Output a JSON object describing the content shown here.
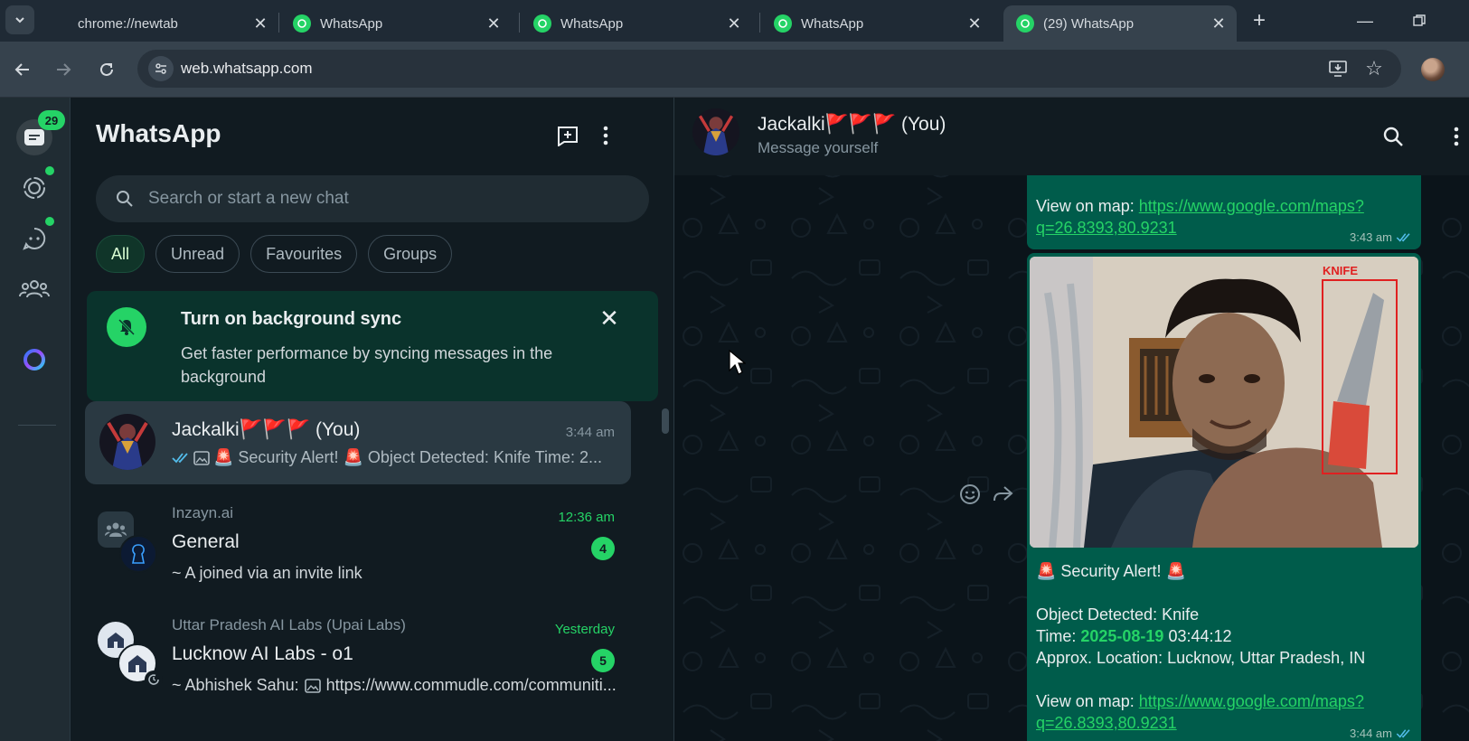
{
  "browser": {
    "tabs": [
      {
        "title": "chrome://newtab",
        "favicon": "none"
      },
      {
        "title": "WhatsApp",
        "favicon": "whatsapp-icon"
      },
      {
        "title": "WhatsApp",
        "favicon": "whatsapp-icon"
      },
      {
        "title": "WhatsApp",
        "favicon": "whatsapp-icon"
      },
      {
        "title": "(29) WhatsApp",
        "favicon": "whatsapp-icon",
        "active": true
      }
    ],
    "url": "web.whatsapp.com"
  },
  "rail": {
    "chats_badge": "29",
    "items": [
      "chats-icon",
      "status-icon",
      "channels-icon",
      "communities-icon",
      "meta-ai-icon"
    ]
  },
  "sidebar": {
    "title": "WhatsApp",
    "search_placeholder": "Search or start a new chat",
    "filters": [
      "All",
      "Unread",
      "Favourites",
      "Groups"
    ],
    "sync_banner": {
      "title": "Turn on background sync",
      "text": "Get faster performance by syncing messages in the background"
    },
    "chats": [
      {
        "name": "Jackalki🚩🚩🚩 (You)",
        "time": "3:44 am",
        "preview": "🚨 Security Alert! 🚨 Object Detected: Knife Time: 2..."
      },
      {
        "community": "Inzayn.ai",
        "name": "General",
        "time": "12:36 am",
        "unread": "4",
        "preview": "~ A joined via an invite link"
      },
      {
        "community": "Uttar Pradesh AI Labs (Upai Labs)",
        "name": "Lucknow AI Labs - o1",
        "time": "Yesterday",
        "unread": "5",
        "preview_author": "~ Abhishek Sahu:",
        "preview": "https://www.commudle.com/communiti..."
      }
    ]
  },
  "conversation": {
    "name": "Jackalki🚩🚩🚩 (You)",
    "status": "Message yourself",
    "messages": [
      {
        "map_label": "View on map:",
        "map_link_1": "https://www.google.com/maps?",
        "map_link_2": "q=26.8393,80.9231",
        "time": "3:43 am"
      },
      {
        "image_label": "KNIFE",
        "alert": "🚨 Security Alert! 🚨",
        "object_line": "Object Detected: Knife",
        "time_label": "Time:",
        "time_date": "2025-08-19",
        "time_clock": "03:44:12",
        "location_line": "Approx. Location: Lucknow, Uttar Pradesh, IN",
        "map_label": "View on map:",
        "map_link_1": "https://www.google.com/maps?",
        "map_link_2": "q=26.8393,80.9231",
        "time": "3:44 am"
      }
    ]
  },
  "colors": {
    "panel": "#111b21",
    "accent": "#25d366",
    "outgoing_bubble": "#005c4b"
  }
}
